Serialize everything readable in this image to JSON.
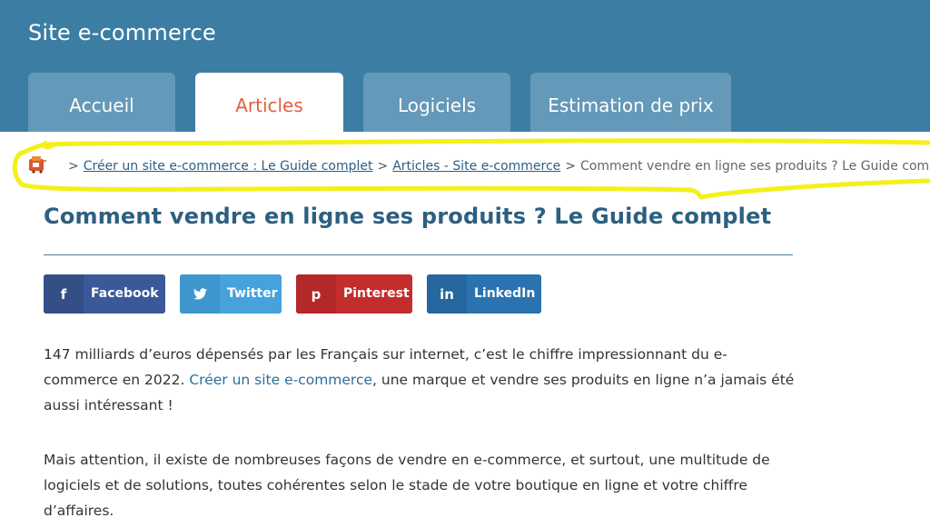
{
  "header": {
    "site_title": "Site e-commerce",
    "tabs": [
      {
        "label": "Accueil",
        "active": false
      },
      {
        "label": "Articles",
        "active": true
      },
      {
        "label": "Logiciels",
        "active": false
      },
      {
        "label": "Estimation de prix",
        "active": false
      }
    ]
  },
  "breadcrumb": {
    "separator": ">",
    "items": [
      {
        "label": "Créer un site e-commerce : Le Guide complet",
        "link": true
      },
      {
        "label": "Articles - Site e-commerce",
        "link": true
      },
      {
        "label": "Comment vendre en ligne ses produits ? Le Guide complet",
        "link": false
      }
    ],
    "home_icon": "shop-logo-icon"
  },
  "article": {
    "title": "Comment vendre en ligne ses produits ? Le Guide complet",
    "share_buttons": [
      {
        "label": "Facebook",
        "icon": "f",
        "color": "#3b5998"
      },
      {
        "label": "Twitter",
        "icon": "twitter-bird",
        "color": "#45a2dd"
      },
      {
        "label": "Pinterest",
        "icon": "p",
        "color": "#c42d2d"
      },
      {
        "label": "LinkedIn",
        "icon": "in",
        "color": "#2a73b0"
      }
    ],
    "paragraph1": {
      "before": "147 milliards d’euros dépensés par les Français sur internet, c’est le chiffre impressionnant du e-commerce en 2022. ",
      "link": "Créer un site e-commerce",
      "after": ", une marque et vendre ses produits en ligne n’a jamais été aussi intéressant !"
    },
    "paragraph2": "Mais attention, il existe de nombreuses façons de vendre en e-commerce, et surtout, une multitude de logiciels et de solutions, toutes cohérentes selon le stade de votre boutique en ligne et votre chiffre d’affaires."
  },
  "colors": {
    "header_bg": "#3c7ea3",
    "tab_bg": "#6499b9",
    "active_tab_text": "#e0603e",
    "title_color": "#2d5f80",
    "highlight": "#f3f01c"
  }
}
